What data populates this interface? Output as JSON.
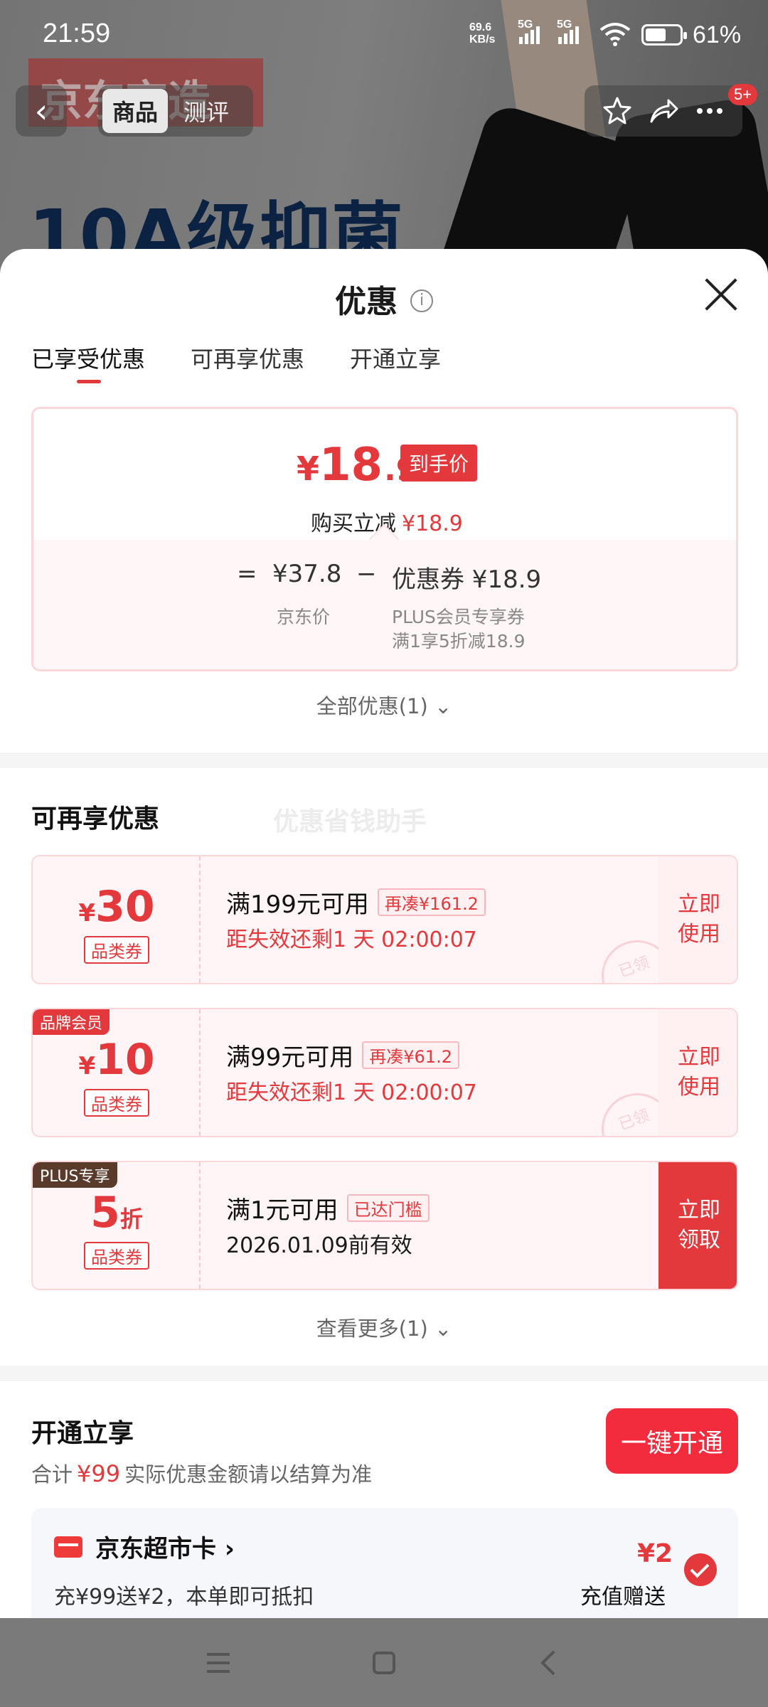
{
  "status_bar": {
    "time": "21:59",
    "net_speed": "69.6 KB/s",
    "net_type": "5G",
    "battery": "61%"
  },
  "background": {
    "banner": "京东京造",
    "headline": "10A级抑菌"
  },
  "nav": {
    "tabs": [
      "商品",
      "测评"
    ],
    "badge": "5+"
  },
  "sheet": {
    "title": "优惠",
    "info_icon": "i",
    "tabs": [
      "已享受优惠",
      "可再享优惠",
      "开通立享"
    ],
    "price": {
      "yen": "¥",
      "int": "18",
      "dec": ".9",
      "tag": "到手价",
      "sub_label": "购买立减",
      "sub_value": "¥18.9",
      "eq": "=",
      "jd_price": "¥37.8",
      "minus": "−",
      "coupon": "优惠券 ¥18.9",
      "jd_price_label": "京东价",
      "coupon_label_1": "PLUS会员专享券",
      "coupon_label_2": "满1享5折减18.9"
    },
    "all_link": "全部优惠(1)",
    "more_title": "可再享优惠",
    "watermark": "优惠省钱助手",
    "coupons": [
      {
        "corner": "",
        "yen": "¥",
        "value": "30",
        "unit": "",
        "type": "品类券",
        "cond": "满199元可用",
        "chip": "再凑¥161.2",
        "exp": "距失效还剩1 天 02:00:07",
        "btn": "立即\n使用",
        "stamp": "已领"
      },
      {
        "corner": "品牌会员",
        "yen": "¥",
        "value": "10",
        "unit": "",
        "type": "品类券",
        "cond": "满99元可用",
        "chip": "再凑¥61.2",
        "exp": "距失效还剩1 天 02:00:07",
        "btn": "立即\n使用",
        "stamp": "已领"
      },
      {
        "corner": "PLUS专享",
        "yen": "",
        "value": "5",
        "unit": "折",
        "type": "品类券",
        "cond": "满1元可用",
        "chip": "已达门槛",
        "exp": "2026.01.09前有效",
        "btn": "立即\n领取",
        "stamp": ""
      }
    ],
    "more_link": "查看更多(1)",
    "open_title": "开通立享",
    "open_sub_pre": "合计",
    "open_sub_amt": "¥99",
    "open_sub_post": "实际优惠金额请以结算为准",
    "open_btn": "一键开通",
    "card": {
      "title": "京东超市卡 ›",
      "desc": "充¥99送¥2，本单即可抵扣",
      "amount": "¥2",
      "note": "充值赠送"
    }
  },
  "colors": {
    "accent": "#e4393c",
    "card_border": "#fbd7dc"
  }
}
